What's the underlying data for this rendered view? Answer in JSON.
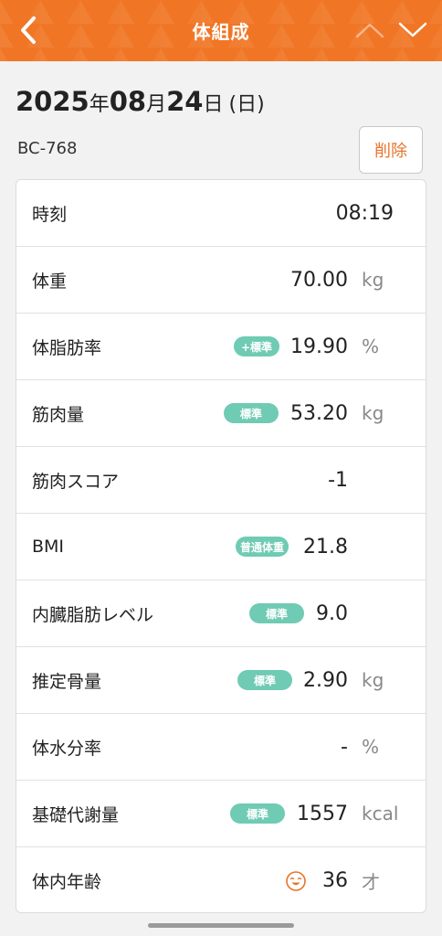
{
  "header": {
    "title": "体組成",
    "back_icon": "chevron-left-icon",
    "prev_icon": "chevron-up-icon",
    "next_icon": "chevron-down-icon",
    "color": "#f07626"
  },
  "date": {
    "year": "2025",
    "year_suffix": "年",
    "month": "08",
    "month_suffix": "月",
    "day": "24",
    "day_suffix": "日",
    "weekday": "(日)"
  },
  "device": {
    "model": "BC-768"
  },
  "actions": {
    "delete_label": "削除"
  },
  "badge_color": "#6fcbb3",
  "rows": [
    {
      "label": "時刻",
      "value": "08:19",
      "unit": "",
      "badge": ""
    },
    {
      "label": "体重",
      "value": "70.00",
      "unit": "kg",
      "badge": ""
    },
    {
      "label": "体脂肪率",
      "value": "19.90",
      "unit": "%",
      "badge": "+標準"
    },
    {
      "label": "筋肉量",
      "value": "53.20",
      "unit": "kg",
      "badge": "標準"
    },
    {
      "label": "筋肉スコア",
      "value": "-1",
      "unit": "",
      "badge": ""
    },
    {
      "label": "BMI",
      "value": "21.8",
      "unit": "",
      "badge": "普通体重"
    },
    {
      "label": "内臓脂肪レベル",
      "value": "9.0",
      "unit": "",
      "badge": "標準"
    },
    {
      "label": "推定骨量",
      "value": "2.90",
      "unit": "kg",
      "badge": "標準"
    },
    {
      "label": "体水分率",
      "value": "-",
      "unit": "%",
      "badge": ""
    },
    {
      "label": "基礎代謝量",
      "value": "1557",
      "unit": "kcal",
      "badge": "標準"
    },
    {
      "label": "体内年齢",
      "value": "36",
      "unit": "才",
      "badge": "",
      "icon": "smiley-face-icon"
    }
  ]
}
